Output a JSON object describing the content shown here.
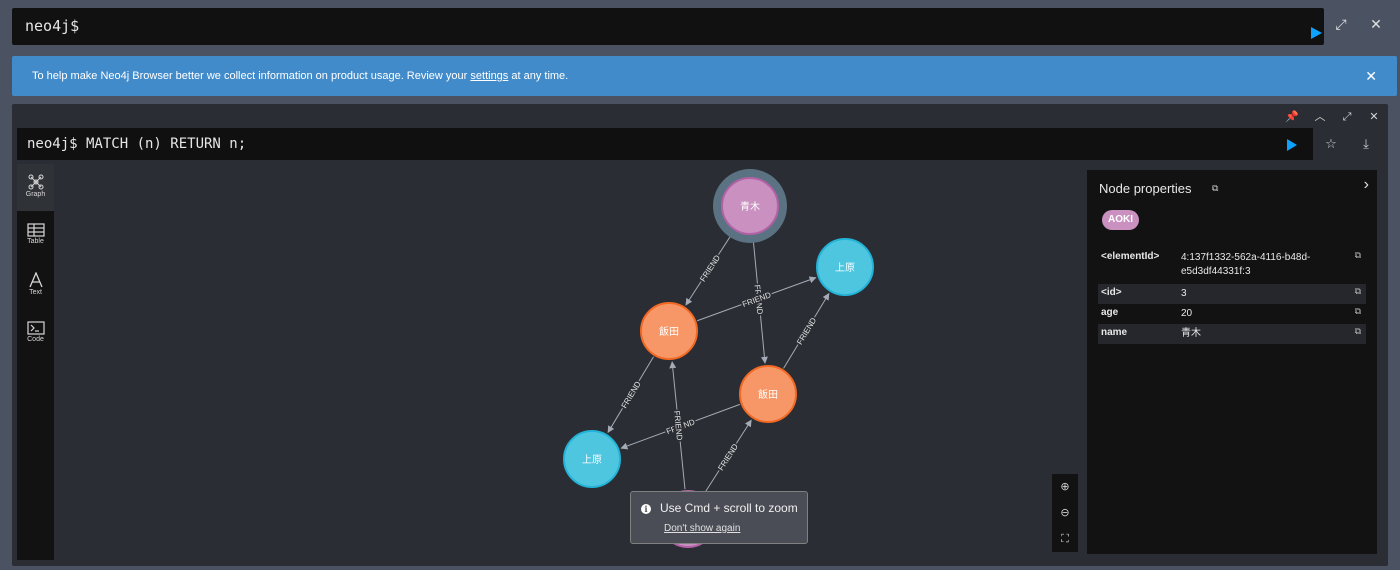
{
  "top_editor": {
    "prompt": "neo4j$"
  },
  "banner": {
    "text_before": "To help make Neo4j Browser better we collect information on product usage. Review your ",
    "link": "settings",
    "text_after": " at any time.",
    "close_glyph": "✕"
  },
  "frame": {
    "query": "neo4j$ MATCH (n) RETURN n;"
  },
  "side_tabs": [
    {
      "label": "Graph",
      "icon": "graph-icon",
      "active": true
    },
    {
      "label": "Table",
      "icon": "table-icon",
      "active": false
    },
    {
      "label": "Text",
      "icon": "text-icon",
      "active": false
    },
    {
      "label": "Code",
      "icon": "code-icon",
      "active": false
    }
  ],
  "graph": {
    "nodes": [
      {
        "id": "n3",
        "name": "青木",
        "label": "AOKI",
        "color": "#c990c0",
        "stroke": "#b261a5",
        "selected": true
      },
      {
        "id": "n_u1",
        "name": "上原",
        "color": "#4fc6e0",
        "stroke": "#23b3d7"
      },
      {
        "id": "n_i1",
        "name": "飯田",
        "color": "#f79767",
        "stroke": "#f36924"
      },
      {
        "id": "n_i2",
        "name": "飯田",
        "color": "#f79767",
        "stroke": "#f36924"
      },
      {
        "id": "n_u2",
        "name": "上原",
        "color": "#4fc6e0",
        "stroke": "#23b3d7"
      },
      {
        "id": "n_p",
        "name": "",
        "color": "#c990c0",
        "stroke": "#b261a5"
      }
    ],
    "relationships": [
      {
        "from": "n3",
        "to": "n_i1",
        "type": "FRIEND"
      },
      {
        "from": "n3",
        "to": "n_i2",
        "type": "FRIEND"
      },
      {
        "from": "n_i1",
        "to": "n_u1",
        "type": "FRIEND"
      },
      {
        "from": "n_i2",
        "to": "n_u1",
        "type": "FRIEND"
      },
      {
        "from": "n_i1",
        "to": "n_u2",
        "type": "FRIEND"
      },
      {
        "from": "n_i2",
        "to": "n_u2",
        "type": "FRIEND"
      },
      {
        "from": "n_p",
        "to": "n_i1",
        "type": "FRIEND"
      },
      {
        "from": "n_p",
        "to": "n_i2",
        "type": "FRIEND"
      }
    ]
  },
  "zoom_tip": {
    "icon": "i",
    "text": "Use Cmd + scroll to zoom",
    "dismiss": "Don't show again"
  },
  "inspector": {
    "title": "Node properties",
    "label_chip": "AOKI",
    "properties": [
      {
        "key": "<elementId>",
        "value": "4:137f1332-562a-4116-b48d-e5d3df44331f:3"
      },
      {
        "key": "<id>",
        "value": "3"
      },
      {
        "key": "age",
        "value": "20"
      },
      {
        "key": "name",
        "value": "青木"
      }
    ]
  }
}
